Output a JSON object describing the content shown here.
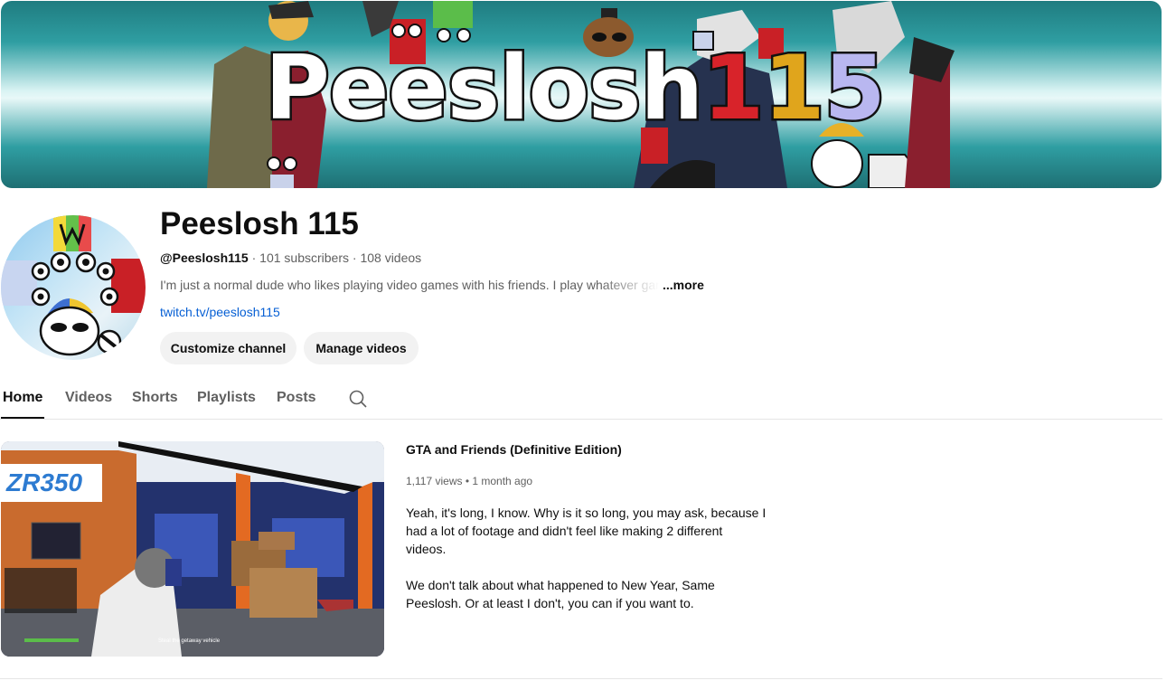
{
  "banner": {
    "title_main": "Peeslosh",
    "title_d1": "1",
    "title_d2": "1",
    "title_d3": "5"
  },
  "channel": {
    "name": "Peeslosh 115",
    "handle": "@Peeslosh115",
    "subscribers": "101 subscribers",
    "videos": "108 videos",
    "separator": " · ",
    "description": "I'm just a normal dude who likes playing video games with his friends. I play whatever gam",
    "more_label": "...more",
    "link": "twitch.tv/peeslosh115",
    "customize_label": "Customize channel",
    "manage_label": "Manage videos"
  },
  "tabs": [
    {
      "label": "Home",
      "active": true
    },
    {
      "label": "Videos"
    },
    {
      "label": "Shorts"
    },
    {
      "label": "Playlists"
    },
    {
      "label": "Posts"
    }
  ],
  "featured": {
    "title": "GTA and Friends (Definitive Edition)",
    "views": "1,117 views",
    "dot": " • ",
    "age": "1 month ago",
    "desc_lines": [
      "Yeah, it's long, I know. Why is it so long, you may ask, because I",
      "had a lot of footage and didn't feel like making 2 different",
      "videos.",
      "",
      "We don't talk about what happened to New Year, Same",
      "Peeslosh. Or at least I don't, you can if you want to."
    ],
    "thumb_sign": "ZR350",
    "thumb_hud": "Steal the getaway vehicle"
  },
  "icons": {
    "search_tab": "search-icon"
  }
}
